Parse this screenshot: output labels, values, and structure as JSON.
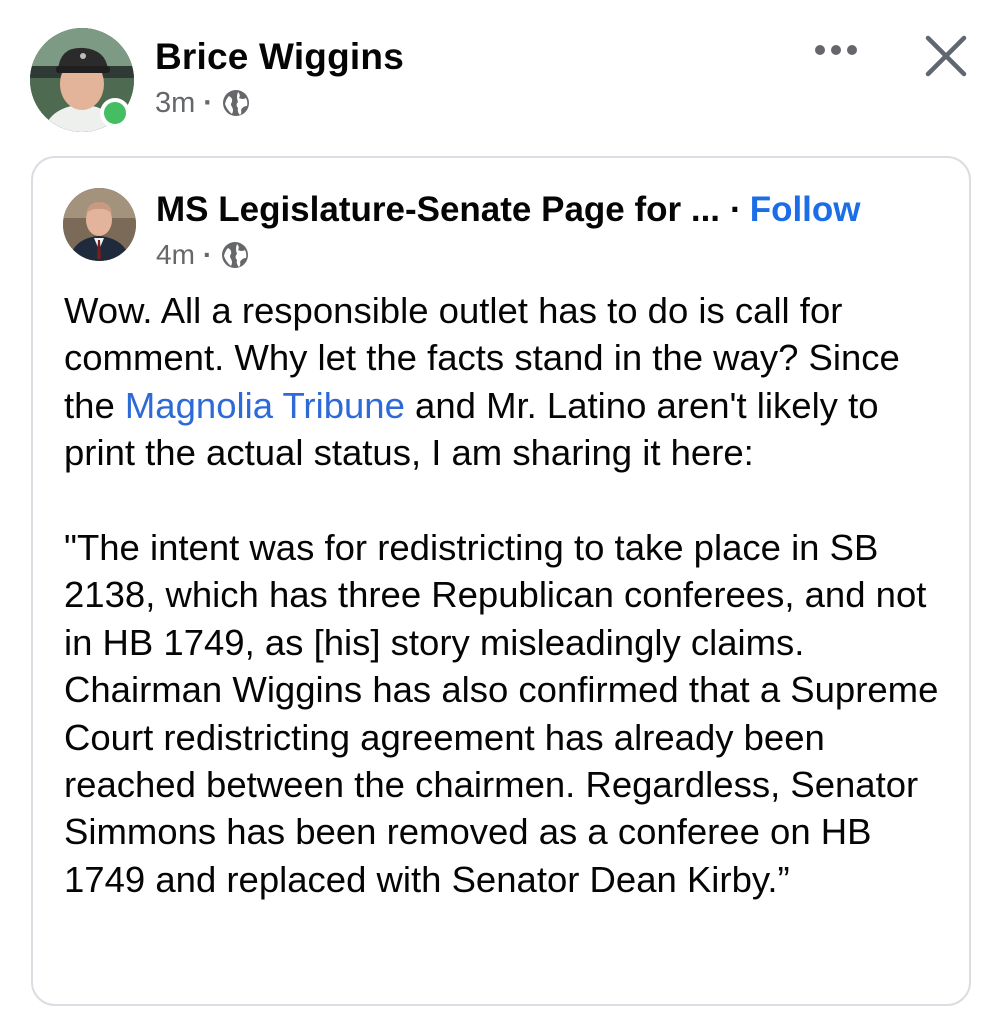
{
  "post": {
    "author": "Brice Wiggins",
    "time": "3m",
    "separator": "·",
    "privacy_icon": "globe-icon",
    "online_status_color": "#45bd62"
  },
  "shared": {
    "page_name": "MS Legislature-Senate Page for ...",
    "follow_separator": "·",
    "follow_label": "Follow",
    "time": "4m",
    "separator": "·",
    "privacy_icon": "globe-icon",
    "text": {
      "p1_before_link": "Wow. All a responsible outlet has to do is call for comment. Why let the facts stand in the way? Since the ",
      "p1_link": "Magnolia Tribune",
      "p1_after_link": " and Mr. Latino aren't likely to print the actual status, I am sharing it here:",
      "p2": "\"The intent was for redistricting to take place in SB 2138, which has three Republican conferees, and not in HB 1749, as [his] story misleadingly claims. Chairman Wiggins has also confirmed that a Supreme Court redistricting agreement has already been reached between the chairmen. Regardless, Senator Simmons has been removed as a conferee on HB 1749 and replaced with Senator Dean Kirby.”"
    }
  },
  "icons": {
    "more": "more-horizontal-icon",
    "close": "close-icon"
  },
  "colors": {
    "link": "#1b6ee6",
    "secondary_text": "#65676b",
    "card_border": "#dadde1"
  }
}
